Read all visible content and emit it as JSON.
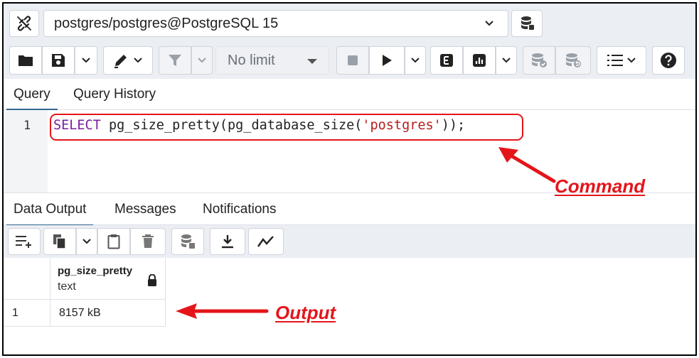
{
  "connection": {
    "label": "postgres/postgres@PostgreSQL 15",
    "icons": [
      "disconnect-icon",
      "database-stack-icon"
    ]
  },
  "toolbar": {
    "limit_label": "No limit",
    "icons": [
      "folder-icon",
      "save-icon",
      "edit-pencil-icon",
      "filter-icon",
      "stop-icon",
      "play-icon",
      "explain-icon",
      "explain-analyze-icon",
      "commit-icon",
      "rollback-icon",
      "macros-icon",
      "help-icon"
    ]
  },
  "query_tabs": [
    {
      "label": "Query",
      "active": true
    },
    {
      "label": "Query History",
      "active": false
    }
  ],
  "editor": {
    "line_number": "1",
    "code_keyword": "SELECT",
    "code_mid": " pg_size_pretty(pg_database_size(",
    "code_string": "'postgres'",
    "code_end": "));"
  },
  "output_tabs": [
    {
      "label": "Data Output",
      "active": true
    },
    {
      "label": "Messages",
      "active": false
    },
    {
      "label": "Notifications",
      "active": false
    }
  ],
  "result": {
    "column_name": "pg_size_pretty",
    "column_type": "text",
    "rows": [
      {
        "row_number": "1",
        "value": "8157 kB"
      }
    ]
  },
  "annotations": {
    "command": "Command",
    "output": "Output"
  },
  "colors": {
    "accent": "#326690",
    "annotation_red": "#e4151a",
    "keyword": "#7b1fa2",
    "string": "#b71c1c"
  }
}
